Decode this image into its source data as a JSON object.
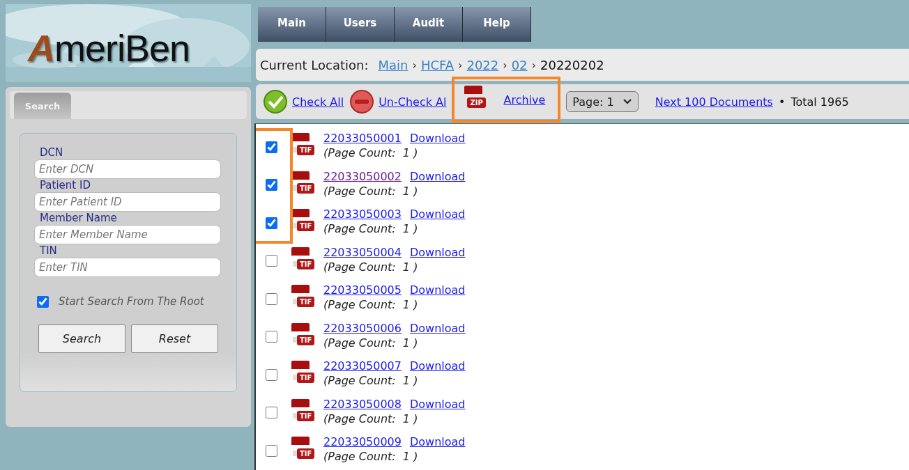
{
  "logo": {
    "text": "AmeriBen"
  },
  "nav": [
    {
      "label": "Main"
    },
    {
      "label": "Users"
    },
    {
      "label": "Audit"
    },
    {
      "label": "Help"
    }
  ],
  "search_panel": {
    "tabs": [
      {
        "label": "Search",
        "selected": true
      }
    ],
    "fields": [
      {
        "label": "DCN",
        "placeholder": "Enter DCN"
      },
      {
        "label": "Patient ID",
        "placeholder": "Enter Patient ID"
      },
      {
        "label": "Member Name",
        "placeholder": "Enter Member Name"
      },
      {
        "label": "TIN",
        "placeholder": "Enter TIN"
      }
    ],
    "root_option": {
      "label": "Start Search From The Root",
      "checked": true
    },
    "buttons": [
      "Search",
      "Reset"
    ]
  },
  "breadcrumb": {
    "label": "Current Location:",
    "items": [
      {
        "text": "Main",
        "link": true
      },
      {
        "text": "HCFA",
        "link": true
      },
      {
        "text": "2022",
        "link": true
      },
      {
        "text": "02",
        "link": true
      },
      {
        "text": "20220202",
        "link": false
      }
    ],
    "separator": "›"
  },
  "toolbar": {
    "actions": [
      {
        "kind": "check",
        "label": "Check All",
        "highlighted": false
      },
      {
        "kind": "uncheck",
        "label": "Un-Check Al",
        "highlighted": false
      },
      {
        "kind": "zip",
        "label": "Archive",
        "highlighted": true,
        "icon_text": "ZIP"
      }
    ],
    "page_select": "Page: 1",
    "next_link": "Next 100 Documents",
    "bullet": "•",
    "total": "Total 1965"
  },
  "documents": [
    {
      "id": "22033050001",
      "download": "Download",
      "page_count": "(Page Count:  1 )",
      "checked": true,
      "visited": false,
      "highlighted": true,
      "icon_text": "TIF"
    },
    {
      "id": "22033050002",
      "download": "Download",
      "page_count": "(Page Count:  1 )",
      "checked": true,
      "visited": true,
      "highlighted": true,
      "icon_text": "TIF"
    },
    {
      "id": "22033050003",
      "download": "Download",
      "page_count": "(Page Count:  1 )",
      "checked": true,
      "visited": false,
      "highlighted": true,
      "icon_text": "TIF"
    },
    {
      "id": "22033050004",
      "download": "Download",
      "page_count": "(Page Count:  1 )",
      "checked": false,
      "visited": false,
      "highlighted": false,
      "icon_text": "TIF"
    },
    {
      "id": "22033050005",
      "download": "Download",
      "page_count": "(Page Count:  1 )",
      "checked": false,
      "visited": false,
      "highlighted": false,
      "icon_text": "TIF"
    },
    {
      "id": "22033050006",
      "download": "Download",
      "page_count": "(Page Count:  1 )",
      "checked": false,
      "visited": false,
      "highlighted": false,
      "icon_text": "TIF"
    },
    {
      "id": "22033050007",
      "download": "Download",
      "page_count": "(Page Count:  1 )",
      "checked": false,
      "visited": false,
      "highlighted": false,
      "icon_text": "TIF"
    },
    {
      "id": "22033050008",
      "download": "Download",
      "page_count": "(Page Count:  1 )",
      "checked": false,
      "visited": false,
      "highlighted": false,
      "icon_text": "TIF"
    },
    {
      "id": "22033050009",
      "download": "Download",
      "page_count": "(Page Count:  1 )",
      "checked": false,
      "visited": false,
      "highlighted": false,
      "icon_text": "TIF"
    }
  ]
}
